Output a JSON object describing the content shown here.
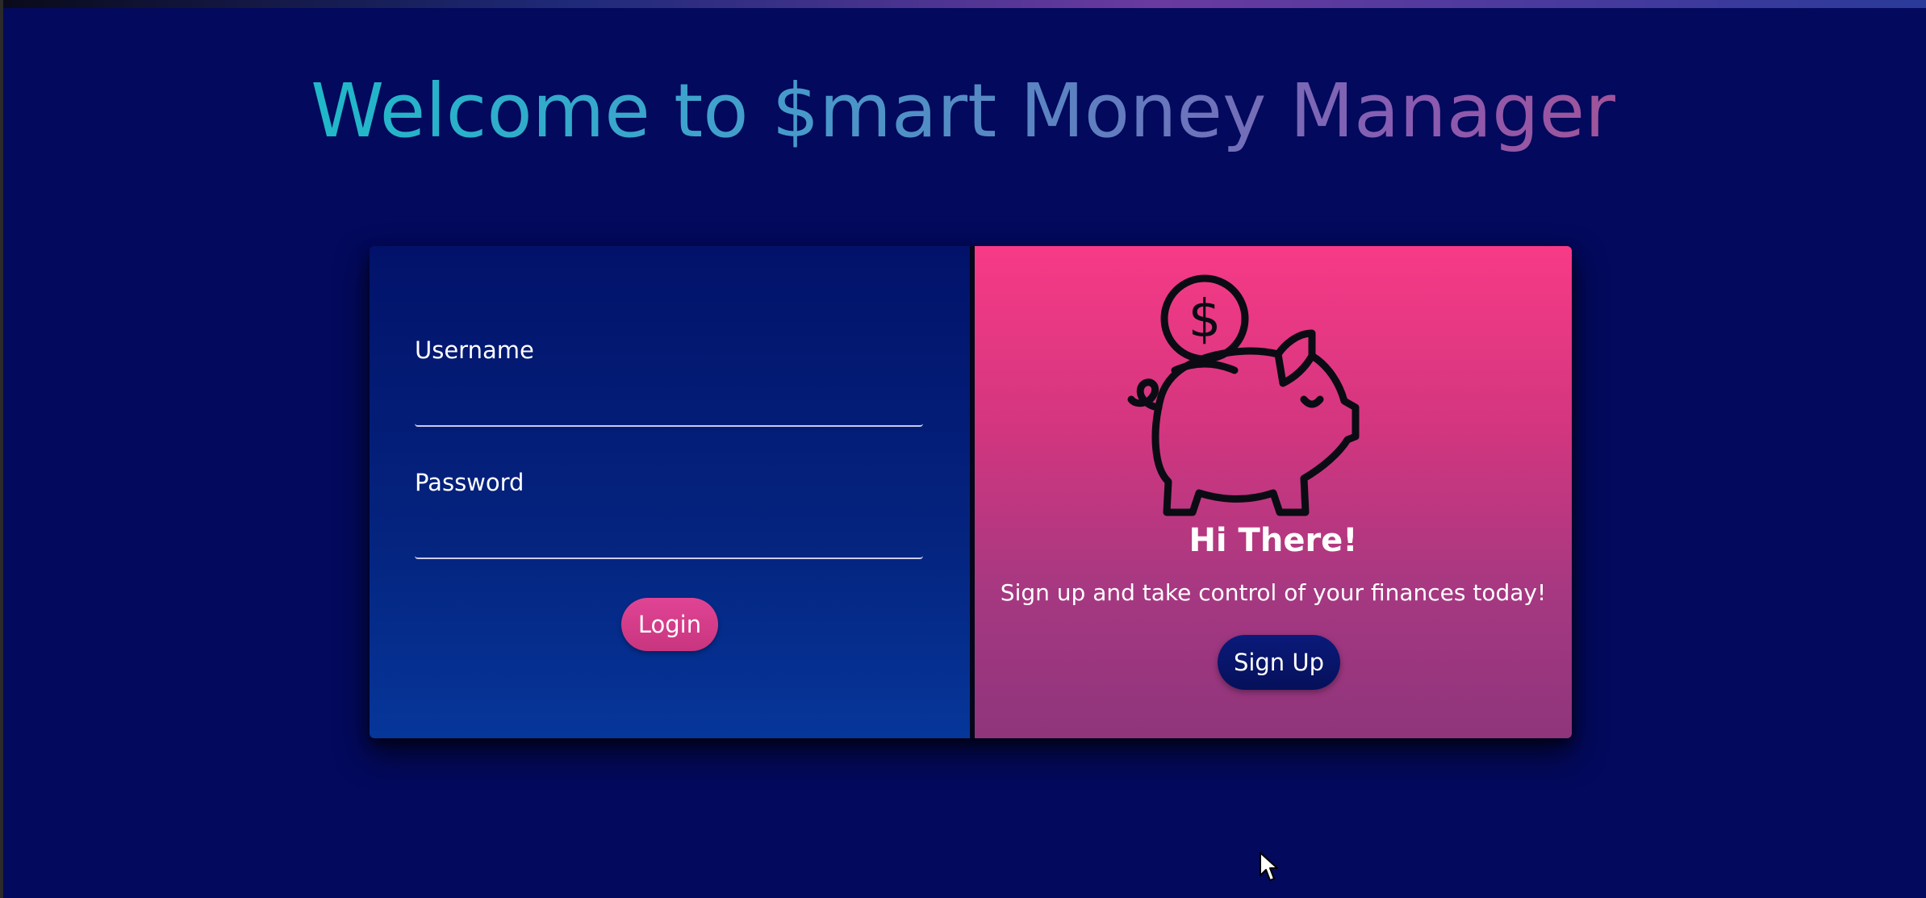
{
  "page": {
    "title": "Welcome to $mart Money Manager"
  },
  "login_form": {
    "username_label": "Username",
    "username_value": "",
    "password_label": "Password",
    "password_value": "",
    "login_label": "Login"
  },
  "signup_panel": {
    "icon": "piggy-bank-icon",
    "heading": "Hi There!",
    "tagline": "Sign up and take control of your finances today!",
    "signup_label": "Sign Up"
  },
  "colors": {
    "background": "#03095c",
    "login_panel": "#04247f",
    "signup_panel": "#f73a87",
    "login_button": "#d83c8a",
    "signup_button": "#0a1a7a"
  }
}
